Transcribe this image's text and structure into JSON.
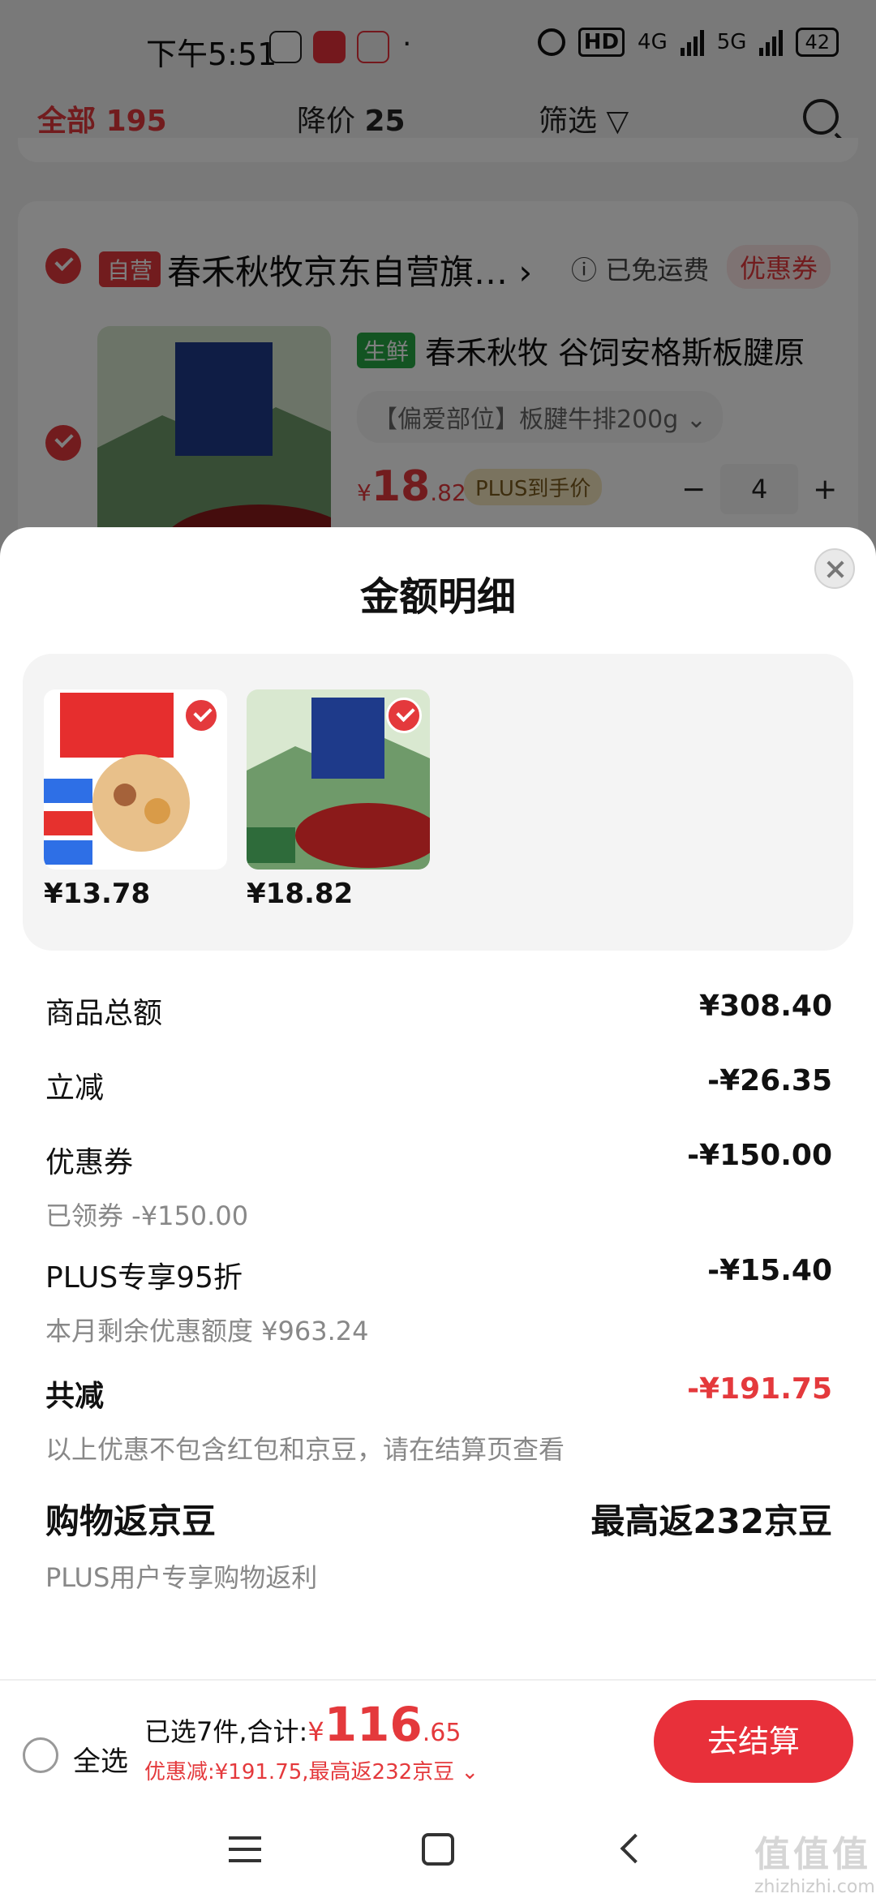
{
  "status_bar": {
    "time": "下午5:51",
    "battery": "42",
    "hd": "HD",
    "net1": "4G",
    "net2": "5G"
  },
  "tabs": {
    "all_label": "全部",
    "all_count": "195",
    "drop_label": "降价",
    "drop_count": "25",
    "filter_label": "筛选"
  },
  "shop": {
    "self_tag": "自营",
    "name": "春禾秋牧京东自营旗…",
    "free_shipping": "已免运费",
    "coupon_label": "优惠券"
  },
  "product": {
    "fresh_tag": "生鲜",
    "name": "春禾秋牧 谷饲安格斯板腱原",
    "spec": "【偏爱部位】板腱牛排200g",
    "price_symbol": "¥",
    "price_int": "18",
    "price_dec": ".82",
    "plus_tag": "PLUS到手价",
    "quantity": "4",
    "minus": "−",
    "plus": "+"
  },
  "sheet": {
    "title": "金额明细",
    "items": [
      {
        "price": "¥13.78",
        "icon": "hotpot-combo-image"
      },
      {
        "price": "¥18.82",
        "icon": "beef-steak-image"
      }
    ],
    "rows": {
      "total": {
        "label": "商品总额",
        "value": "¥308.40"
      },
      "instant": {
        "label": "立减",
        "value": "-¥26.35"
      },
      "coupon": {
        "label": "优惠券",
        "value": "-¥150.00",
        "sub": "已领券 -¥150.00"
      },
      "plus": {
        "label": "PLUS专享95折",
        "value": "-¥15.40",
        "sub": "本月剩余优惠额度 ¥963.24"
      },
      "sum": {
        "label": "共减",
        "value": "-¥191.75",
        "sub": "以上优惠不包含红包和京豆，请在结算页查看"
      },
      "beans": {
        "label": "购物返京豆",
        "value": "最高返232京豆",
        "sub": "PLUS用户专享购物返利"
      }
    }
  },
  "bottom": {
    "select_all": "全选",
    "selected": "已选7件,合计:",
    "currency": "¥",
    "total_int": "116",
    "total_dec": ".65",
    "discount_line": "优惠减:¥191.75,最高返232京豆 ⌄",
    "checkout": "去结算"
  },
  "watermark": {
    "cn": "值值值",
    "en": "zhizhizhi.com"
  },
  "colors": {
    "accent": "#e4393c",
    "fresh": "#27a844",
    "plus_bg": "#f5e6bf"
  }
}
